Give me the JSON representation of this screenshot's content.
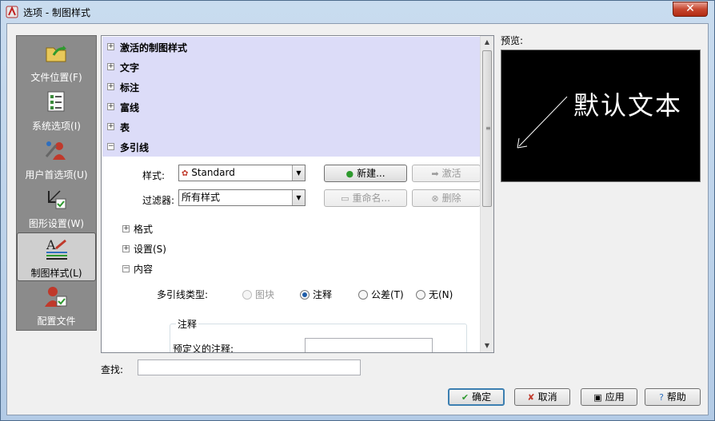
{
  "window": {
    "title": "选项 - 制图样式",
    "close_glyph": "✕"
  },
  "nav": {
    "items": [
      {
        "label": "文件位置(F)",
        "icon": "folder-arrow-icon"
      },
      {
        "label": "系统选项(I)",
        "icon": "checklist-icon"
      },
      {
        "label": "用户首选项(U)",
        "icon": "user-tools-icon"
      },
      {
        "label": "图形设置(W)",
        "icon": "graphics-settings-icon"
      },
      {
        "label": "制图样式(L)",
        "icon": "drafting-style-icon",
        "selected": true
      },
      {
        "label": "配置文件",
        "icon": "profile-user-icon"
      }
    ]
  },
  "tree": {
    "top_nodes": [
      "激活的制图样式",
      "文字",
      "标注",
      "富线",
      "表",
      "多引线"
    ],
    "style_label": "样式:",
    "style_value": "Standard",
    "filter_label": "过滤器:",
    "filter_value": "所有样式",
    "new_button": "新建...",
    "activate_button": "激活",
    "rename_button": "重命名...",
    "delete_button": "删除",
    "sub_nodes": [
      "格式",
      "设置(S)",
      "内容"
    ],
    "multileader_type_label": "多引线类型:",
    "radio_options": [
      {
        "label": "图块",
        "state": "disabled"
      },
      {
        "label": "注释",
        "state": "checked"
      },
      {
        "label": "公差(T)",
        "state": "unchecked"
      },
      {
        "label": "无(N)",
        "state": "unchecked"
      }
    ],
    "group_title": "注释",
    "predefined_label": "预定义的注释:",
    "predefined_value": ""
  },
  "preview": {
    "label": "预览:",
    "sample_text": "默认文本"
  },
  "find": {
    "label": "查找:",
    "value": ""
  },
  "buttons": {
    "ok": "确定",
    "cancel": "取消",
    "apply": "应用",
    "help": "帮助"
  },
  "colors": {
    "tree_highlight": "#dcdcf8",
    "nav_bg": "#8b8b8b",
    "preview_bg": "#000000"
  }
}
